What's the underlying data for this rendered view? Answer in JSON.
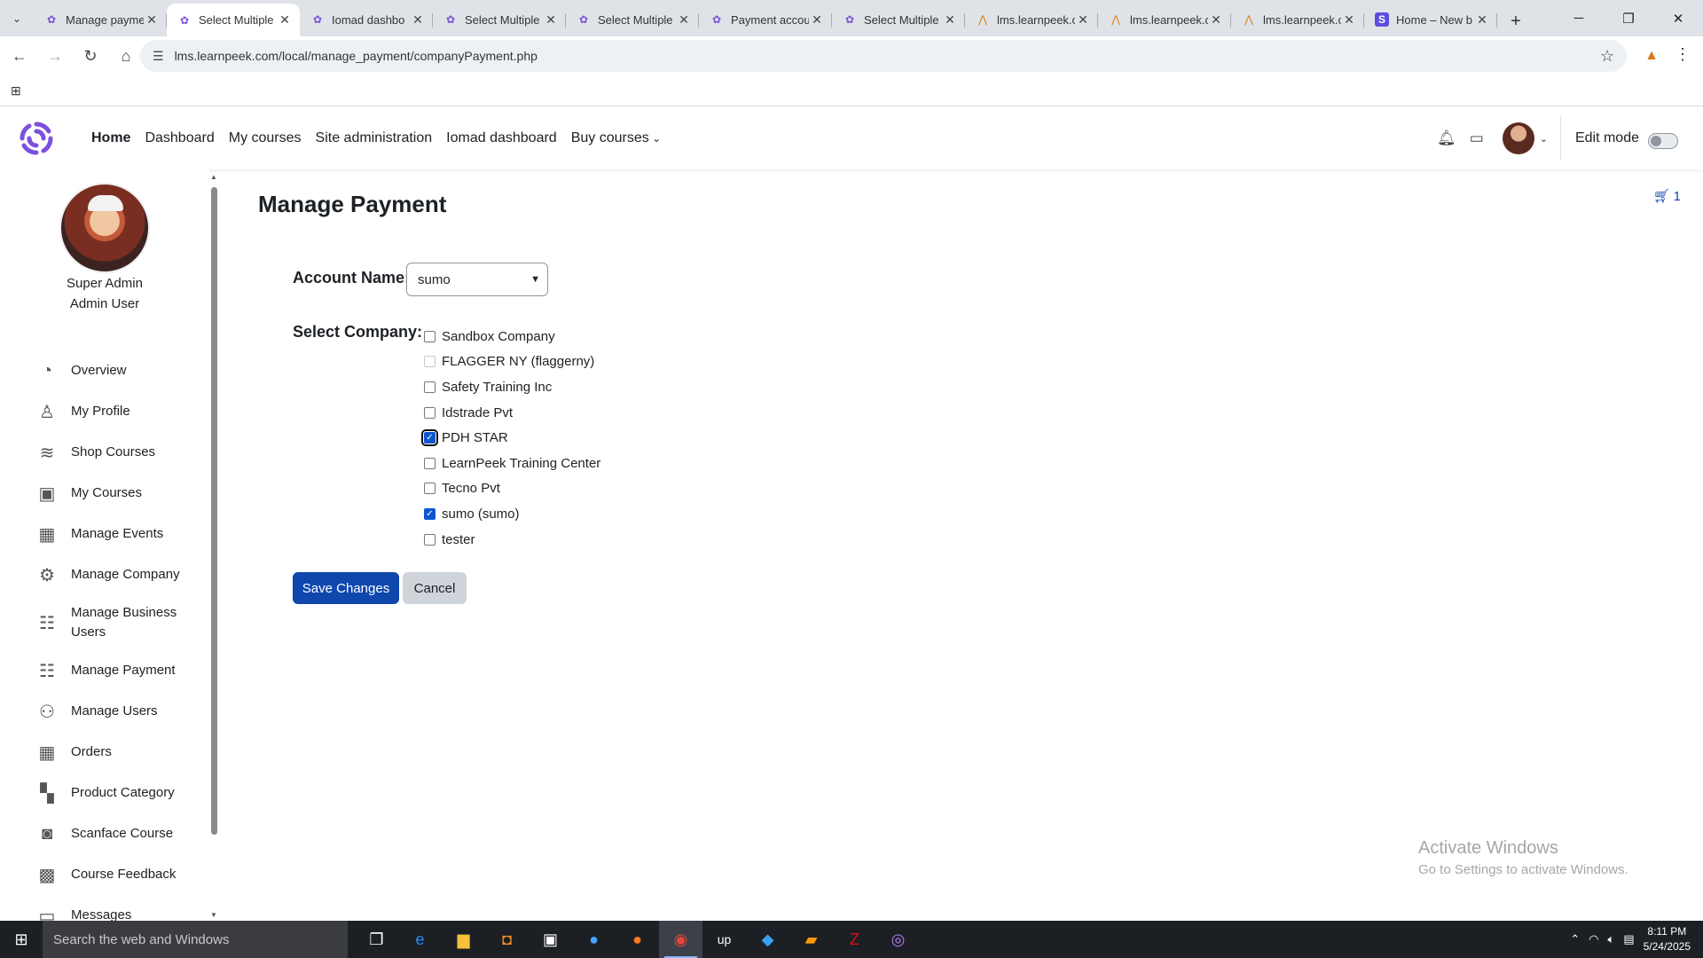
{
  "browser": {
    "tabs": [
      {
        "title": "Manage payme",
        "icon": "moodle-flower",
        "active": false
      },
      {
        "title": "Select Multiple",
        "icon": "moodle-flower",
        "active": true
      },
      {
        "title": "Iomad dashbo",
        "icon": "moodle-flower",
        "active": false
      },
      {
        "title": "Select Multiple",
        "icon": "moodle-flower",
        "active": false
      },
      {
        "title": "Select Multiple",
        "icon": "moodle-flower",
        "active": false
      },
      {
        "title": "Payment accou",
        "icon": "moodle-flower",
        "active": false
      },
      {
        "title": "Select Multiple",
        "icon": "moodle-flower",
        "active": false
      },
      {
        "title": "lms.learnpeek.c",
        "icon": "learnpeek-logo",
        "active": false
      },
      {
        "title": "lms.learnpeek.c",
        "icon": "learnpeek-logo",
        "active": false
      },
      {
        "title": "lms.learnpeek.c",
        "icon": "learnpeek-logo",
        "active": false
      },
      {
        "title": "Home – New b",
        "icon": "s-logo",
        "active": false
      }
    ],
    "url": "lms.learnpeek.com/local/manage_payment/companyPayment.php"
  },
  "navbar": {
    "links": [
      "Home",
      "Dashboard",
      "My courses",
      "Site administration",
      "Iomad dashboard",
      "Buy courses"
    ],
    "active_link": "Home",
    "edit_mode_label": "Edit mode",
    "edit_mode_on": false
  },
  "sidebar": {
    "user_line1": "Super Admin",
    "user_line2": "Admin User",
    "items": [
      {
        "label": "Overview",
        "icon": "speedometer-icon"
      },
      {
        "label": "My Profile",
        "icon": "user-icon"
      },
      {
        "label": "Shop Courses",
        "icon": "layers-icon"
      },
      {
        "label": "My Courses",
        "icon": "course-book-icon"
      },
      {
        "label": "Manage Events",
        "icon": "calendar-icon"
      },
      {
        "label": "Manage Company",
        "icon": "company-gear-icon"
      },
      {
        "label": "Manage Business Users",
        "icon": "list-doc-icon"
      },
      {
        "label": "Manage Payment",
        "icon": "list-doc-icon"
      },
      {
        "label": "Manage Users",
        "icon": "users-icon"
      },
      {
        "label": "Orders",
        "icon": "cart-grid-icon"
      },
      {
        "label": "Product Category",
        "icon": "grid-icon"
      },
      {
        "label": "Scanface Course",
        "icon": "camera-icon"
      },
      {
        "label": "Course Feedback",
        "icon": "feedback-icon"
      },
      {
        "label": "Messages",
        "icon": "message-icon"
      }
    ]
  },
  "main": {
    "title": "Manage Payment",
    "cart_count": "1",
    "account_label": "Account Name:",
    "account_value": "sumo",
    "company_label": "Select Company:",
    "companies": [
      {
        "name": "Sandbox Company",
        "checked": false,
        "disabled": false
      },
      {
        "name": "FLAGGER NY (flaggerny)",
        "checked": false,
        "disabled": true
      },
      {
        "name": "Safety Training Inc",
        "checked": false,
        "disabled": false
      },
      {
        "name": "Idstrade Pvt",
        "checked": false,
        "disabled": false
      },
      {
        "name": "PDH STAR",
        "checked": true,
        "disabled": false
      },
      {
        "name": "LearnPeek Training Center",
        "checked": false,
        "disabled": false
      },
      {
        "name": "Tecno Pvt",
        "checked": false,
        "disabled": false
      },
      {
        "name": "sumo (sumo)",
        "checked": true,
        "disabled": false
      },
      {
        "name": "tester",
        "checked": false,
        "disabled": false
      }
    ],
    "save_label": "Save Changes",
    "cancel_label": "Cancel"
  },
  "watermark": {
    "line1": "Activate Windows",
    "line2": "Go to Settings to activate Windows."
  },
  "taskbar": {
    "search_placeholder": "Search the web and Windows",
    "time": "8:11 PM",
    "date": "5/24/2025"
  },
  "colors": {
    "primary": "#0f47ad",
    "secondary": "#ced4da",
    "logo": "#7b4fe0"
  }
}
